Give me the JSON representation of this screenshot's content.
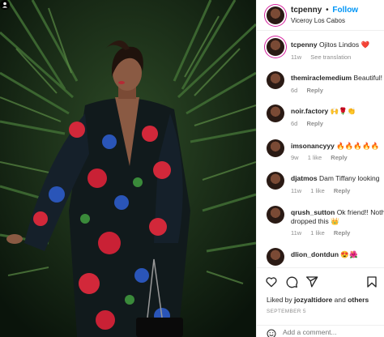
{
  "header": {
    "username": "tcpenny",
    "dot": "•",
    "follow_label": "Follow",
    "location": "Viceroy Los Cabos"
  },
  "caption": {
    "username": "tcpenny",
    "text": "Ojitos Lindos ❤️",
    "time": "11w",
    "see_translation": "See translation"
  },
  "comments": [
    {
      "username": "themiraclemedium",
      "text": "Beautiful!",
      "time": "6d",
      "likes": "",
      "reply": "Reply"
    },
    {
      "username": "noir.factory",
      "text": "🙌🌹👏",
      "time": "6d",
      "likes": "",
      "reply": "Reply"
    },
    {
      "username": "imsonancyyy",
      "text": "🔥🔥🔥🔥🔥",
      "time": "9w",
      "likes": "1 like",
      "reply": "Reply"
    },
    {
      "username": "djatmos",
      "text": "Dam Tiffany looking",
      "time": "11w",
      "likes": "1 like",
      "reply": "Reply"
    },
    {
      "username": "qrush_sutton",
      "text": "Ok friend!! Nothing dropped this 👑",
      "time": "11w",
      "likes": "1 like",
      "reply": "Reply"
    },
    {
      "username": "dlion_dontdun",
      "text": "😍🌺",
      "time": "",
      "likes": "",
      "reply": ""
    }
  ],
  "likes": {
    "prefix": "Liked by",
    "user": "jozyaltidore",
    "joiner": "and",
    "others": "others"
  },
  "date": "SEPTEMBER 5",
  "add_comment": {
    "placeholder": "Add a comment..."
  },
  "icons": [
    "heart-icon",
    "comment-icon",
    "share-icon",
    "bookmark-icon",
    "emoji-icon",
    "user-tag-icon"
  ],
  "colors": {
    "follow": "#0095f6",
    "secondary": "#8e8e8e",
    "border": "#efefef"
  }
}
